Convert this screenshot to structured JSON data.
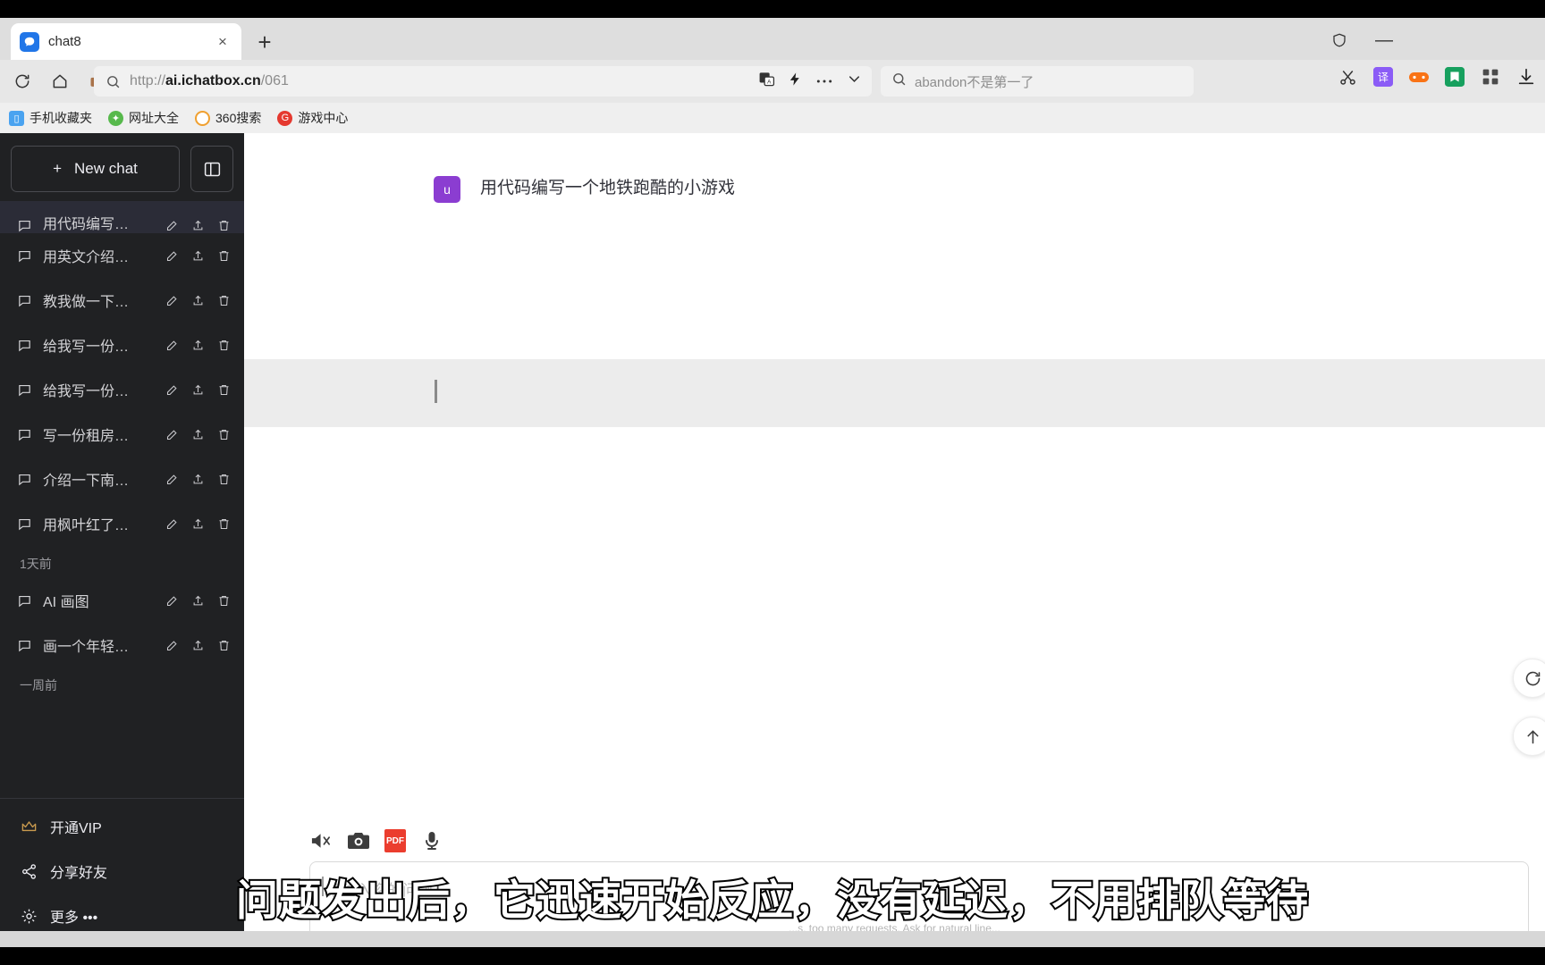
{
  "browser": {
    "tab": {
      "title": "chat8",
      "favicon": "chat-bubble-icon",
      "close": "×"
    },
    "new_tab_label": "+",
    "window_controls": {
      "minimize": "—",
      "shield": "shield-icon"
    },
    "nav": {
      "reload": "reload-icon",
      "home": "home-icon",
      "briefcase": "briefcase-icon"
    },
    "omnibox": {
      "url_scheme": "http://",
      "url_domain": "ai.ichatbox.cn",
      "url_path": "/061",
      "full_url": "http://ai.ichatbox.cn/061",
      "right_icons": [
        "translate-icon",
        "lightning-icon",
        "more-dots-icon",
        "chevron-down-icon"
      ]
    },
    "search": {
      "value": "abandon不是第一了",
      "icon": "search-icon"
    },
    "extensions": [
      "scissors-icon",
      "translate-ext-icon",
      "game-ext-icon",
      "book-ext-icon",
      "apps-grid-icon",
      "download-icon"
    ],
    "bookmarks": [
      {
        "label": "手机收藏夹",
        "icon": "phone-icon",
        "color": "#4aa3f0"
      },
      {
        "label": "网址大全",
        "icon": "nav-icon",
        "color": "#57b94c"
      },
      {
        "label": "360搜索",
        "icon": "search360-icon",
        "color": "#f0a030"
      },
      {
        "label": "游戏中心",
        "icon": "game-icon",
        "color": "#e5392f"
      }
    ]
  },
  "sidebar": {
    "new_chat": {
      "label": "New chat",
      "plus": "+"
    },
    "collapse": "panel-toggle-icon",
    "chats": [
      {
        "name": "用代码编写…",
        "active": true
      },
      {
        "name": "用英文介绍…",
        "active": false
      },
      {
        "name": "教我做一下…",
        "active": false
      },
      {
        "name": "给我写一份…",
        "active": false
      },
      {
        "name": "给我写一份…",
        "active": false
      },
      {
        "name": "写一份租房…",
        "active": false
      },
      {
        "name": "介绍一下南…",
        "active": false
      },
      {
        "name": "用枫叶红了…",
        "active": false
      }
    ],
    "group_label_1": "1天前",
    "chats_group1": [
      {
        "name": "AI 画图"
      },
      {
        "name": "画一个年轻…"
      }
    ],
    "group_label_2": "一周前",
    "bottom_links": [
      {
        "label": "开通VIP",
        "icon": "crown-icon",
        "color": "#c99a4e"
      },
      {
        "label": "分享好友",
        "icon": "share-icon",
        "color": "#ececf1"
      },
      {
        "label": "更多 •••",
        "icon": "gear-icon",
        "color": "#ececf1"
      }
    ],
    "item_actions": [
      "edit-icon",
      "share-icon",
      "delete-icon"
    ]
  },
  "chat": {
    "user_avatar": "u",
    "user_message": "用代码编写一个地铁跑酷的小游戏",
    "assistant_typing": true
  },
  "composer": {
    "tools": [
      "mute-icon",
      "camera-icon",
      "pdf-icon",
      "microphone-icon"
    ],
    "pdf_label": "PDF",
    "placeholder": "请输入您的问题",
    "value": "",
    "disclaimer": "...s, too many requests. Ask for natural line..."
  },
  "float_buttons": [
    {
      "name": "refresh-button",
      "icon": "refresh-circle-icon"
    },
    {
      "name": "scroll-top-button",
      "icon": "arrow-up-icon"
    }
  ],
  "subtitle": "问题发出后，它迅速开始反应，没有延迟，不用排队等待",
  "colors": {
    "sidebar_bg": "#202123",
    "avatar_purple": "#8b3dd1",
    "pdf_red": "#eb3d2e",
    "assistant_bg": "#ececec"
  }
}
